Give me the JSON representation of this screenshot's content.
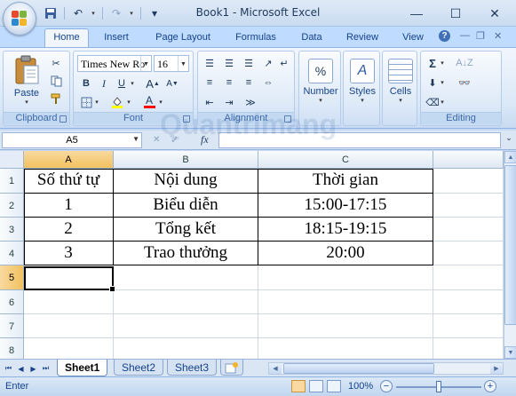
{
  "window": {
    "title": "Book1 - Microsoft Excel",
    "minimize_glyph": "—",
    "maximize_glyph": "☐",
    "close_glyph": "✕"
  },
  "qat": {
    "undo_glyph": "↶",
    "redo_glyph": "↷",
    "customize_glyph": "▾"
  },
  "ribbon": {
    "tabs": [
      "Home",
      "Insert",
      "Page Layout",
      "Formulas",
      "Data",
      "Review",
      "View"
    ],
    "active_tab": "Home",
    "help_glyph": "?",
    "clipboard": {
      "label": "Clipboard",
      "paste_label": "Paste"
    },
    "font": {
      "label": "Font",
      "font_name": "Times New Ro",
      "font_size": "16",
      "bold": "B",
      "italic": "I",
      "underline": "U",
      "grow": "A",
      "shrink": "A",
      "color": "A",
      "font_color_hex": "#ff0000",
      "fill_color_hex": "#ffff00"
    },
    "alignment": {
      "label": "Alignment"
    },
    "number": {
      "label": "Number",
      "glyph": "%"
    },
    "styles": {
      "label": "Styles",
      "glyph": "A"
    },
    "cells": {
      "label": "Cells"
    },
    "editing": {
      "label": "Editing",
      "sum_glyph": "Σ"
    }
  },
  "formula_bar": {
    "name_box": "A5",
    "formula": "",
    "fx_label": "fx"
  },
  "grid": {
    "columns": [
      "A",
      "B",
      "C"
    ],
    "selected_column": "A",
    "rows": [
      "1",
      "2",
      "3",
      "4",
      "5",
      "6",
      "7",
      "8"
    ],
    "selected_row": "5",
    "table": [
      [
        "Số thứ tự",
        "Nội dung",
        "Thời gian"
      ],
      [
        "1",
        "Biểu diễn",
        "15:00-17:15"
      ],
      [
        "2",
        "Tổng kết",
        "18:15-19:15"
      ],
      [
        "3",
        "Trao thưởng",
        "20:00"
      ]
    ]
  },
  "sheets": {
    "tabs": [
      "Sheet1",
      "Sheet2",
      "Sheet3"
    ],
    "active": "Sheet1"
  },
  "status": {
    "mode": "Enter",
    "zoom": "100%"
  },
  "watermark": "Quantrimang"
}
